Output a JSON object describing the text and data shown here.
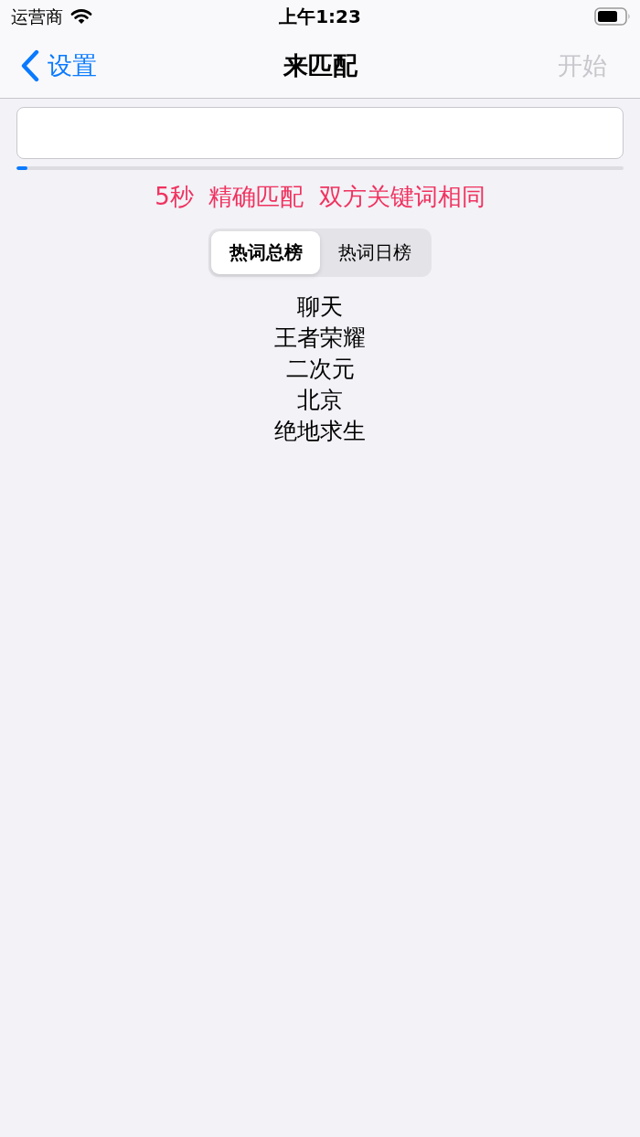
{
  "status_bar": {
    "carrier": "运营商",
    "time": "上午1:23"
  },
  "nav_bar": {
    "back_label": "设置",
    "title": "来匹配",
    "action": {
      "label": "开始",
      "disabled": true
    }
  },
  "progress": {
    "level": 0.018
  },
  "match_info": "5秒  精确匹配  双方关键词相同",
  "tabs": [
    {
      "label": "热词总榜",
      "selected": true
    },
    {
      "label": "热词日榜",
      "selected": false
    }
  ],
  "hot_words": [
    "聊天",
    "王者荣耀",
    "二次元",
    "北京",
    "绝地求生"
  ]
}
